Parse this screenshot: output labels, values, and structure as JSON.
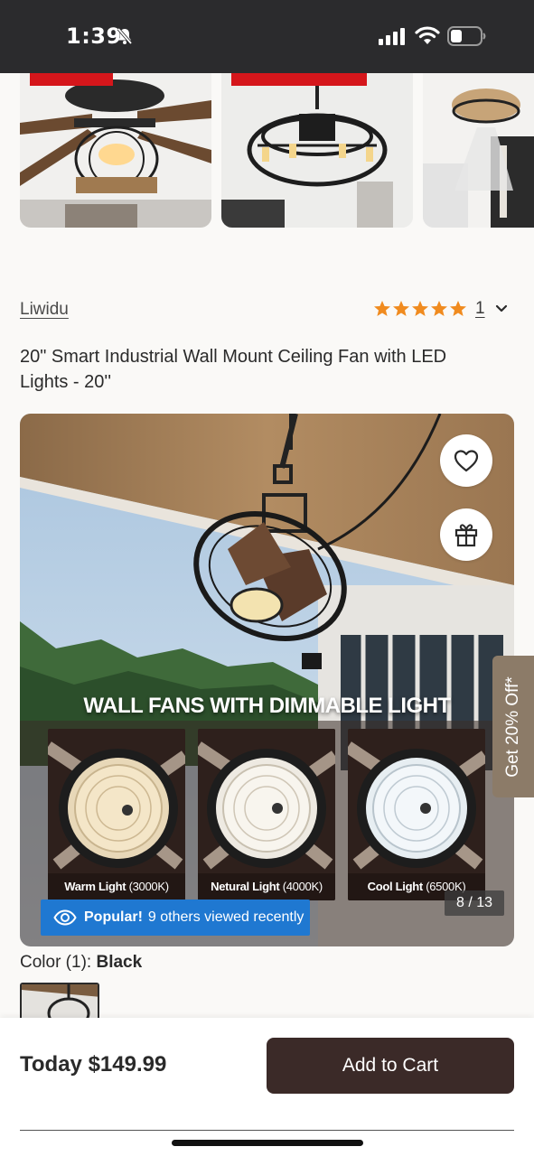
{
  "status_bar": {
    "time": "1:39"
  },
  "brand": {
    "name": "Liwidu"
  },
  "rating": {
    "stars": 5,
    "count": "1"
  },
  "product": {
    "title": "20\" Smart Industrial Wall Mount Ceiling Fan with LED Lights - 20''"
  },
  "gallery": {
    "headline": "WALL FANS WITH DIMMABLE LIGHT",
    "light_options": [
      {
        "name": "Warm Light",
        "temp": "(3000K)"
      },
      {
        "name": "Netural Light",
        "temp": "(4000K)"
      },
      {
        "name": "Cool Light",
        "temp": "(6500K)"
      }
    ],
    "popular_label": "Popular!",
    "popular_text": "9 others viewed recently",
    "counter": "8 / 13"
  },
  "promo_tab": {
    "label": "Get 20% Off*"
  },
  "color": {
    "label_prefix": "Color (1):",
    "selected": "Black"
  },
  "bottom_bar": {
    "price": "Today $149.99",
    "add_to_cart": "Add to Cart"
  },
  "colors": {
    "accent_dark": "#3b2a28",
    "star": "#f08b1f",
    "popular_blue": "#1f78d1",
    "promo": "#8c7b68"
  }
}
